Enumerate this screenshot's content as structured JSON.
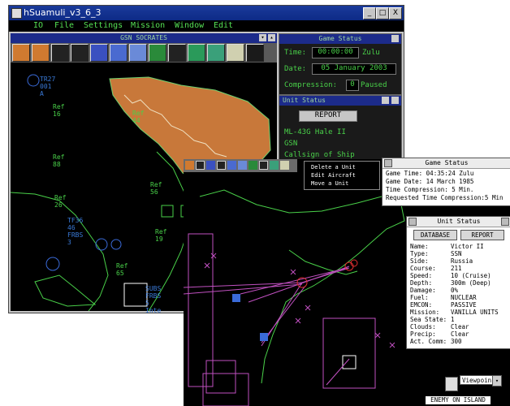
{
  "window": {
    "title": "hSuamuli_v3_6_3",
    "min_glyph": "_",
    "max_glyph": "□",
    "close_glyph": "X"
  },
  "menu": [
    "IO",
    "File",
    "Settings",
    "Mission",
    "Window",
    "Edit"
  ],
  "map_panel": {
    "title": "GSN SOCRATES",
    "units": [
      {
        "id": "u1",
        "label": "TR27\n001\nA"
      },
      {
        "id": "u2",
        "label": "Ref\n16"
      },
      {
        "id": "u3",
        "label": "Ref\n44"
      },
      {
        "id": "u4",
        "label": "Ref\n88"
      },
      {
        "id": "u5",
        "label": "Ref\n26"
      },
      {
        "id": "u6",
        "label": "Ref\n56"
      },
      {
        "id": "u7",
        "label": "TF36\n46\nFRBS\n3"
      },
      {
        "id": "u8",
        "label": "Ref\n19"
      },
      {
        "id": "u9",
        "label": "Ref\n65"
      },
      {
        "id": "u10",
        "label": "SUBS\nFRBS\n5\nInte"
      }
    ]
  },
  "game_status_back": {
    "title": "Game Status",
    "time_label": "Time:",
    "time_value": "00:00:00",
    "zone": "Zulu",
    "date_label": "Date:",
    "date_value": "05 January 2003",
    "compression_label": "Compression:",
    "compression_value": "0",
    "state": "Paused"
  },
  "unit_status_back": {
    "title": "Unit Status",
    "button": "REPORT",
    "lines": [
      "ML-43G Hale II",
      "GSN",
      "Callsign of Ship"
    ]
  },
  "context_menu": {
    "items": [
      "Delete a Unit",
      "Edit Aircraft",
      "Move a Unit"
    ]
  },
  "game_status_front": {
    "title": "Game Status",
    "rows": [
      {
        "label": "Game Time:",
        "value": "04:35:24  Zulu"
      },
      {
        "label": "Game Date:",
        "value": "14 March 1985"
      },
      {
        "label": "Time Compression:",
        "value": "5  Min."
      },
      {
        "label": "Requested Time Compression:",
        "value": "5    Min"
      }
    ]
  },
  "unit_status_front": {
    "title": "Unit Status",
    "database_button": "DATABASE",
    "report_button": "REPORT",
    "rows": [
      {
        "label": "Name:",
        "value": "Victor II"
      },
      {
        "label": "Type:",
        "value": "SSN"
      },
      {
        "label": "Side:",
        "value": "Russia"
      },
      {
        "label": "Course:",
        "value": "211"
      },
      {
        "label": "Speed:",
        "value": "10 (Cruise)"
      },
      {
        "label": "Depth:",
        "value": "300m (Deep)"
      },
      {
        "label": "Damage:",
        "value": "0%"
      },
      {
        "label": "Fuel:",
        "value": "NUCLEAR"
      },
      {
        "label": "EMCON:",
        "value": "PASSIVE"
      },
      {
        "label": "Mission:",
        "value": "VANILLA UNITS"
      },
      {
        "label": "Sea State:",
        "value": "1"
      },
      {
        "label": "Clouds:",
        "value": "Clear"
      },
      {
        "label": "Precip:",
        "value": "Clear"
      },
      {
        "label": "Act. Comm:",
        "value": "300"
      }
    ]
  },
  "viewpoint": {
    "value": "Viewpoin"
  },
  "status_text": "ENEMY ON ISLAND",
  "colors": {
    "title_bar": "#1a3a9a",
    "map_bg": "#000000",
    "text_green": "#49d049",
    "terrain": "#c8783a",
    "contact_purple": "#c050c0",
    "contact_red": "#e03030",
    "panel_bar": "#1c2b8a"
  }
}
